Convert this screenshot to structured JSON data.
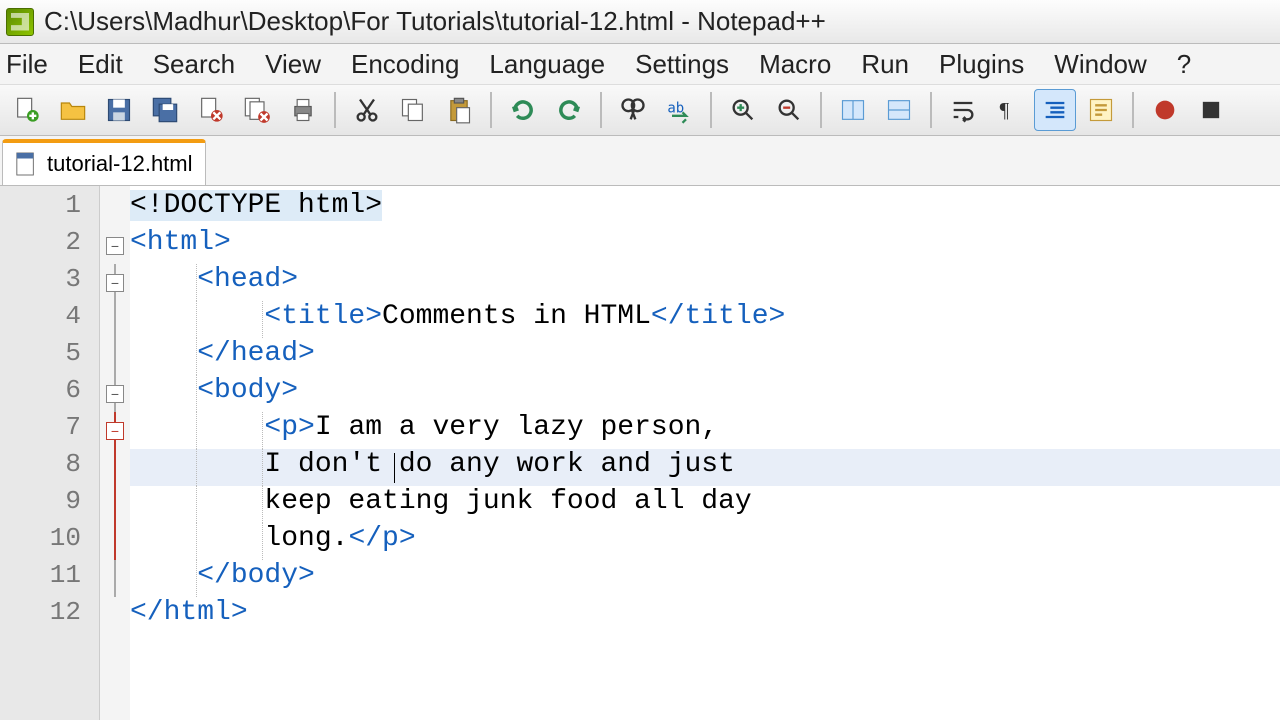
{
  "window": {
    "title": "C:\\Users\\Madhur\\Desktop\\For Tutorials\\tutorial-12.html - Notepad++"
  },
  "menu": {
    "file": "File",
    "edit": "Edit",
    "search": "Search",
    "view": "View",
    "encoding": "Encoding",
    "language": "Language",
    "settings": "Settings",
    "macro": "Macro",
    "run": "Run",
    "plugins": "Plugins",
    "window": "Window",
    "help": "?"
  },
  "toolbar_icons": {
    "new": "new-file-icon",
    "open": "open-folder-icon",
    "save": "save-icon",
    "saveall": "save-all-icon",
    "close": "close-file-icon",
    "closeall": "close-all-icon",
    "print": "print-icon",
    "cut": "cut-icon",
    "copy": "copy-icon",
    "paste": "paste-icon",
    "undo": "undo-icon",
    "redo": "redo-icon",
    "find": "find-icon",
    "replace": "replace-icon",
    "zoomin": "zoom-in-icon",
    "zoomout": "zoom-out-icon",
    "sync": "sync-v-icon",
    "sync2": "sync-h-icon",
    "wrap": "word-wrap-icon",
    "allchars": "show-chars-icon",
    "indent": "indent-guide-icon",
    "userlang": "user-lang-icon",
    "record": "record-macro-icon",
    "stop": "stop-macro-icon"
  },
  "tab": {
    "name": "tutorial-12.html"
  },
  "code": {
    "lines": [
      {
        "n": "1",
        "html": "<span class='hl-doctype'>&lt;!DOCTYPE html&gt;</span>"
      },
      {
        "n": "2",
        "html": "<span class='tag'>&lt;html&gt;</span>"
      },
      {
        "n": "3",
        "html": "    <span class='tag'>&lt;head&gt;</span>"
      },
      {
        "n": "4",
        "html": "        <span class='tag'>&lt;title&gt;</span><span class='text'>Comments in HTML</span><span class='tag'>&lt;/title&gt;</span>"
      },
      {
        "n": "5",
        "html": "    <span class='tag'>&lt;/head&gt;</span>"
      },
      {
        "n": "6",
        "html": "    <span class='tag'>&lt;body&gt;</span>"
      },
      {
        "n": "7",
        "html": "        <span class='tag'>&lt;p&gt;</span><span class='text'>I am a very lazy person,</span>"
      },
      {
        "n": "8",
        "html": "        <span class='text'>I don't do any work and just</span>"
      },
      {
        "n": "9",
        "html": "        <span class='text'>keep eating junk food all day</span>"
      },
      {
        "n": "10",
        "html": "        <span class='text'>long.</span><span class='tag'>&lt;/p&gt;</span>"
      },
      {
        "n": "11",
        "html": "    <span class='tag'>&lt;/body&gt;</span>"
      },
      {
        "n": "12",
        "html": "<span class='tag'>&lt;/html&gt;</span>"
      }
    ],
    "current_line": 8
  }
}
